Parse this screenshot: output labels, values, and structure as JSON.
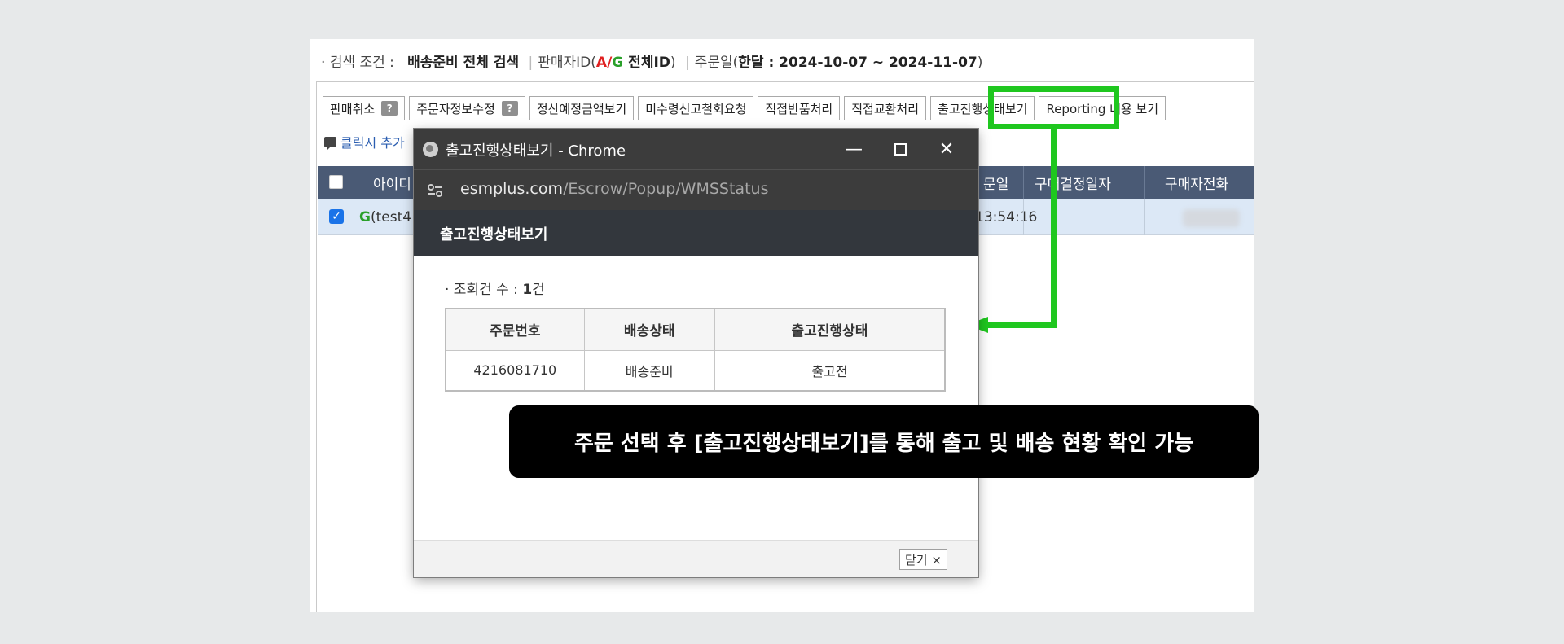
{
  "search": {
    "bullet": "·",
    "label": "검색 조건 :",
    "scope": "배송준비 전체 검색",
    "sep": "|",
    "seller_prefix": "판매자ID(",
    "seller_a": "A",
    "seller_slash": "/",
    "seller_g": "G",
    "seller_rest": " 전체ID",
    "seller_close": ")",
    "order_date_prefix": "주문일(",
    "order_date_range": "한달 : 2024-10-07 ~ 2024-11-07",
    "order_date_close": ")"
  },
  "toolbar": {
    "buttons": [
      {
        "label": "판매취소",
        "help": "?"
      },
      {
        "label": "주문자정보수정",
        "help": "?"
      },
      {
        "label": "정산예정금액보기"
      },
      {
        "label": "미수령신고철회요청"
      },
      {
        "label": "직접반품처리"
      },
      {
        "label": "직접교환처리"
      },
      {
        "label": "출고진행상태보기"
      },
      {
        "label": "Reporting 내용 보기"
      }
    ],
    "click_note": "클릭시 추가"
  },
  "grid": {
    "headers": {
      "id": "아이디",
      "date": "문일",
      "confirm": "구매결정일자",
      "phone": "구매자전화"
    },
    "row": {
      "id_g": "G",
      "id_rest": "(test4",
      "time": "13:54:16",
      "phone_tail": "-"
    }
  },
  "popup": {
    "window_title": "출고진행상태보기 - Chrome",
    "url_host": "esmplus.com",
    "url_path": "/Escrow/Popup/WMSStatus",
    "header": "출고진행상태보기",
    "count_prefix": "· 조회건 수 : ",
    "count_value": "1",
    "count_suffix": "건",
    "table": {
      "columns": [
        "주문번호",
        "배송상태",
        "출고진행상태"
      ],
      "rows": [
        [
          "4216081710",
          "배송준비",
          "출고전"
        ]
      ]
    },
    "close_label": "닫기 ×"
  },
  "callout": {
    "text": "주문 선택 후 [출고진행상태보기]를 통해 출고 및 배송 현황 확인 가능"
  },
  "colors": {
    "highlight": "#1fc71f",
    "grid_header": "#4a5a75",
    "selected_row": "#dce8f6",
    "popup_titlebar": "#3c3c3c",
    "popup_header": "#33373d"
  }
}
